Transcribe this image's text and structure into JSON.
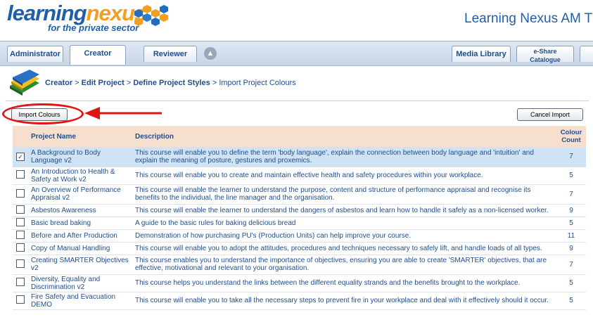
{
  "header": {
    "logo_main_1": "learning",
    "logo_main_2": "nexus",
    "logo_sub": "for the private sector",
    "app_title": "Learning Nexus AM T"
  },
  "tabs": {
    "administrator": "Administrator",
    "creator": "Creator",
    "reviewer": "Reviewer",
    "media_library": "Media Library",
    "eshare_1": "e-Share",
    "eshare_2": "Catalogue",
    "active": "Creator"
  },
  "breadcrumb": {
    "creator": "Creator",
    "sep1": " > ",
    "edit_project": "Edit Project",
    "sep2": " > ",
    "define_styles": "Define Project Styles",
    "sep3": " > ",
    "current": "Import Project Colours"
  },
  "buttons": {
    "import": "Import Colours",
    "cancel": "Cancel Import"
  },
  "table": {
    "headers": {
      "name": "Project Name",
      "description": "Description",
      "count_1": "Colour",
      "count_2": "Count"
    },
    "rows": [
      {
        "name": "A Background to Body Language v2",
        "description": "This course will enable you to define the term 'body language', explain the connection between body language and 'intuition' and explain the meaning of posture, gestures and proxemics.",
        "count": "7",
        "checked": true
      },
      {
        "name": "An Introduction to Health & Safety at Work v2",
        "description": "This course will enable you to create and maintain effective health and safety procedures within your workplace.",
        "count": "5",
        "checked": false
      },
      {
        "name": "An Overview of Performance Appraisal v2",
        "description": "This course will enable the learner to understand the purpose, content and structure of performance appraisal and recognise its benefits to the individual, the line manager and the organisation.",
        "count": "7",
        "checked": false
      },
      {
        "name": "Asbestos Awareness",
        "description": "This course will enable the learner to understand the dangers of asbestos and learn how to handle it safely as a non-licensed worker.",
        "count": "9",
        "checked": false
      },
      {
        "name": "Basic bread baking",
        "description": "A guide to the basic rules for baking delicious bread",
        "count": "5",
        "checked": false
      },
      {
        "name": "Before and After Production",
        "description": "Demonstration of how purchasing PU's (Production Units) can help improve your course.",
        "count": "11",
        "checked": false
      },
      {
        "name": "Copy of Manual Handling",
        "description": "This course will enable you to adopt the attitudes, procedures and techniques necessary to safely lift, and handle loads of all types.",
        "count": "9",
        "checked": false
      },
      {
        "name": "Creating SMARTER Objectives v2",
        "description": "This course enables you to understand the importance of objectives, ensuring you are able to create 'SMARTER' objectives, that are effective, motivational and relevant to your organisation.",
        "count": "7",
        "checked": false
      },
      {
        "name": "Diversity, Equality and Discrimination v2",
        "description": "This course helps you understand the links between the different equality strands and the benefits brought to the workplace.",
        "count": "5",
        "checked": false
      },
      {
        "name": "Fire Safety and Evacuation DEMO",
        "description": "This course will enable you to take all the necessary steps to prevent fire in your workplace and deal with it effectively should it occur.",
        "count": "5",
        "checked": false
      }
    ]
  },
  "colors": {
    "brand_blue": "#1f5fa8",
    "brand_orange": "#f0a020",
    "header_row": "#f6dfcd",
    "selected_row": "#cfe3f5",
    "annotation_red": "#e11414"
  }
}
